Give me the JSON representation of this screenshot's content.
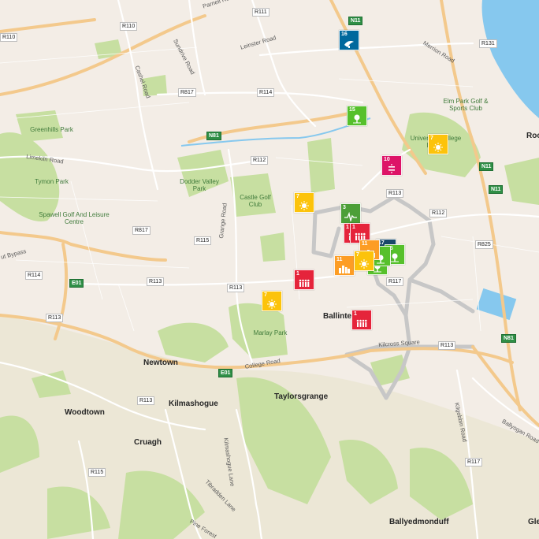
{
  "map": {
    "colors": {
      "land": "#f3ede6",
      "park": "#c7dfa1",
      "water": "#86c8ee",
      "motorway": "#f3c98c",
      "road": "#ffffff",
      "district": "#c7c7c7"
    },
    "roads": [
      {
        "label": "R110",
        "type": "regional"
      },
      {
        "label": "R110",
        "type": "regional"
      },
      {
        "label": "R111",
        "type": "regional"
      },
      {
        "label": "R131",
        "type": "regional"
      },
      {
        "label": "R114",
        "type": "regional"
      },
      {
        "label": "R817",
        "type": "regional"
      },
      {
        "label": "R112",
        "type": "regional"
      },
      {
        "label": "R113",
        "type": "regional"
      },
      {
        "label": "R112",
        "type": "regional"
      },
      {
        "label": "R817",
        "type": "regional"
      },
      {
        "label": "R115",
        "type": "regional"
      },
      {
        "label": "R825",
        "type": "regional"
      },
      {
        "label": "R114",
        "type": "regional"
      },
      {
        "label": "R113",
        "type": "regional"
      },
      {
        "label": "R113",
        "type": "regional"
      },
      {
        "label": "R117",
        "type": "regional"
      },
      {
        "label": "R113",
        "type": "regional"
      },
      {
        "label": "R113",
        "type": "regional"
      },
      {
        "label": "R113",
        "type": "regional"
      },
      {
        "label": "R115",
        "type": "regional"
      },
      {
        "label": "R117",
        "type": "regional"
      },
      {
        "label": "N11",
        "type": "national"
      },
      {
        "label": "N11",
        "type": "national"
      },
      {
        "label": "N11",
        "type": "national"
      },
      {
        "label": "N81",
        "type": "national"
      },
      {
        "label": "N81",
        "type": "national"
      },
      {
        "label": "E01",
        "type": "national"
      },
      {
        "label": "E01",
        "type": "national"
      }
    ],
    "street_labels": [
      "Parnell Road",
      "Sundrive Road",
      "Leinster Road",
      "Cashel Road",
      "Merrion Road",
      "Limekiln Road",
      "Grange Road",
      "College Road",
      "Kilcross Square",
      "Kilgobbin Road",
      "Ballyogan Road",
      "Kilmashogue Lane",
      "Tibradden Lane",
      "Pine Forest",
      "ut Bypass"
    ],
    "park_labels": [
      "Greenhills Park",
      "Tymon Park",
      "Spawell Golf And Leisure Centre",
      "Dodder Valley Park",
      "Castle Golf Club",
      "Marlay Park",
      "Elm Park Golf & Sports Club",
      "University College Dublin"
    ],
    "place_labels": [
      "Newtown",
      "Woodtown",
      "Kilmashogue",
      "Taylorsgrange",
      "Cruagh",
      "Ballinteer",
      "Ballyedmonduff",
      "Glen",
      "Rock"
    ],
    "sdg_markers": [
      {
        "goal": "15",
        "color": "#56c02b",
        "icon": "tree-icon"
      },
      {
        "goal": "7",
        "color": "#fcc30b",
        "icon": "sun-icon"
      },
      {
        "goal": "16",
        "color": "#00689d",
        "icon": "dove-icon"
      },
      {
        "goal": "10",
        "color": "#dd1367",
        "icon": "equality-icon"
      },
      {
        "goal": "7",
        "color": "#fcc30b",
        "icon": "sun-icon"
      },
      {
        "goal": "3",
        "color": "#4c9f38",
        "icon": "heartbeat-icon"
      },
      {
        "goal": "1",
        "color": "#e5243b",
        "icon": "people-icon"
      },
      {
        "goal": "1",
        "color": "#e5243b",
        "icon": "people-icon"
      },
      {
        "goal": "7",
        "color": "#fcc30b",
        "icon": "sun-icon"
      },
      {
        "goal": "11",
        "color": "#fd9d24",
        "icon": "city-icon"
      },
      {
        "goal": "17",
        "color": "#19486a",
        "icon": "partnership-icon"
      },
      {
        "goal": "15",
        "color": "#56c02b",
        "icon": "tree-icon"
      },
      {
        "goal": "15",
        "color": "#56c02b",
        "icon": "tree-icon"
      },
      {
        "goal": "15",
        "color": "#56c02b",
        "icon": "tree-icon"
      },
      {
        "goal": "11",
        "color": "#fd9d24",
        "icon": "city-icon"
      },
      {
        "goal": "1",
        "color": "#e5243b",
        "icon": "people-icon"
      },
      {
        "goal": "7",
        "color": "#fcc30b",
        "icon": "sun-icon"
      },
      {
        "goal": "1",
        "color": "#e5243b",
        "icon": "people-icon"
      }
    ]
  }
}
